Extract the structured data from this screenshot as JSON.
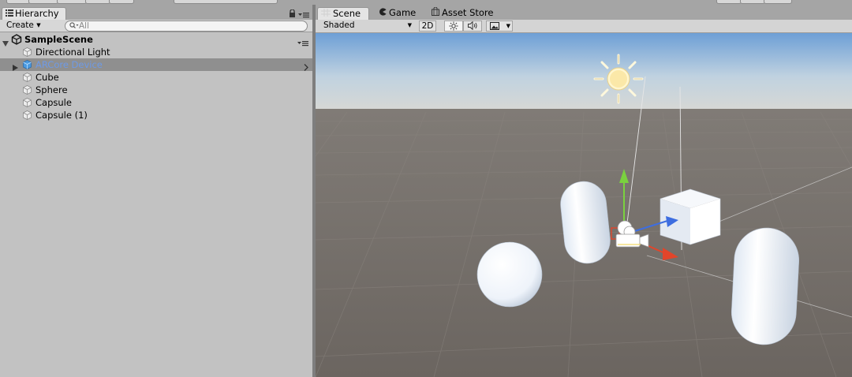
{
  "hierarchy": {
    "tab_label": "Hierarchy",
    "create_label": "Create",
    "search_placeholder": "All",
    "scene_name": "SampleScene",
    "items": [
      {
        "label": "Directional Light"
      },
      {
        "label": "ARCore Device"
      },
      {
        "label": "Cube"
      },
      {
        "label": "Sphere"
      },
      {
        "label": "Capsule"
      },
      {
        "label": "Capsule (1)"
      }
    ],
    "selected_item": "ARCore Device"
  },
  "scene_panel": {
    "tabs": [
      {
        "label": "Scene",
        "active": true
      },
      {
        "label": "Game",
        "active": false
      },
      {
        "label": "Asset Store",
        "active": false
      }
    ],
    "draw_mode": "Shaded",
    "mode_2d_label": "2D"
  },
  "icons": {
    "hierarchy_tab": "list-icon",
    "scene_tab": "grid-icon",
    "game_tab": "pacman-icon",
    "asset_store_tab": "shopping-bag-icon",
    "lighting_toggle": "sun-icon",
    "audio_toggle": "speaker-icon",
    "effects_toggle": "image-icon",
    "unity_scene": "unity-logo-icon",
    "gameobject": "cube-icon"
  },
  "colors": {
    "selection_text": "#6e9ae6",
    "selection_bg": "#8f8f8f",
    "ground": "#6b6560",
    "sky_top": "#6d9fd6",
    "gizmo_y": "#7ad13f",
    "gizmo_x": "#e2452a",
    "gizmo_z": "#3e6ee0"
  }
}
